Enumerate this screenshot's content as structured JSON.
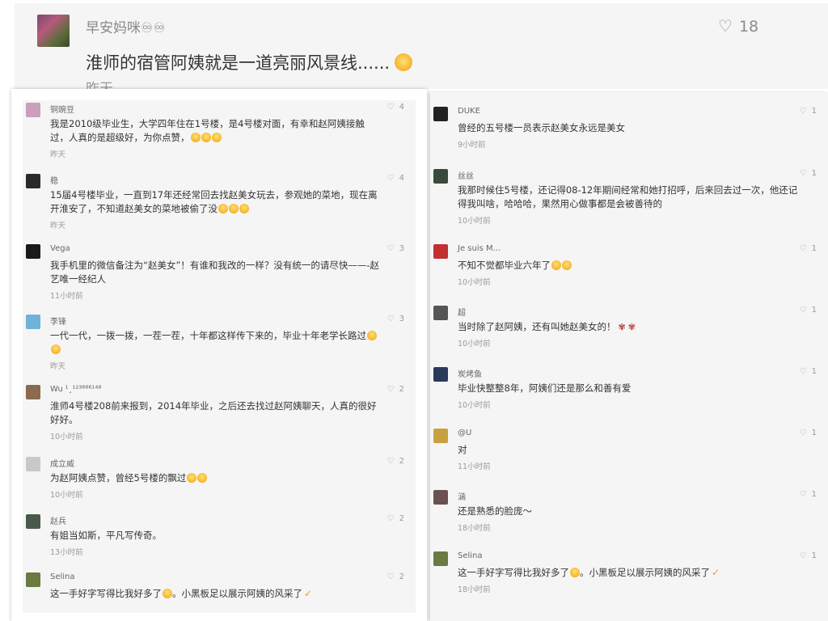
{
  "post": {
    "username": "早安妈咪",
    "username_suffix": "♾♾",
    "likes": "18",
    "text": "淮师的宿管阿姨就是一道亮丽风景线......",
    "date": "昨天"
  },
  "left_comments": [
    {
      "user": "铜豌豆",
      "likes": "4",
      "text": "我是2010级毕业生，大学四年住在1号楼，是4号楼对面，有幸和赵阿姨接触过，人真的是超级好，为你点赞，",
      "emoji": 3,
      "time": "昨天",
      "avatar": "#c8a0b8"
    },
    {
      "user": "稳",
      "likes": "4",
      "text": "15届4号楼毕业，一直到17年还经常回去找赵美女玩去，参观她的菜地，现在离开淮安了，不知道赵美女的菜地被偷了没",
      "emoji": 3,
      "time": "昨天",
      "avatar": "#2a2a2a"
    },
    {
      "user": "Vega",
      "likes": "3",
      "text": "我手机里的微信备注为“赵美女”！有谁和我改的一样？没有统一的请尽快——-赵艺唯一经纪人",
      "emoji": 0,
      "time": "11小时前",
      "avatar": "#1a1a1a"
    },
    {
      "user": "李锋",
      "likes": "3",
      "text": "一代一代，一拨一拨，一茬一茬，十年都这样传下来的，毕业十年老学长路过",
      "emoji": 2,
      "time": "昨天",
      "avatar": "#6fb3d8"
    },
    {
      "user": "Wu ¹¸¹²³⁶⁶⁶¹⁴⁸",
      "likes": "2",
      "text": "淮师4号楼208前来报到，2014年毕业，之后还去找过赵阿姨聊天，人真的很好好好。",
      "emoji": 0,
      "time": "10小时前",
      "avatar": "#8a6a50"
    },
    {
      "user": "成立威",
      "likes": "2",
      "text": "为赵阿姨点赞，曾经5号楼的飘过",
      "emoji": 2,
      "time": "10小时前",
      "avatar": "#c9c9c9"
    },
    {
      "user": "赵兵",
      "likes": "2",
      "text": "有姐当如斯，平凡写传奇。",
      "emoji": 0,
      "time": "13小时前",
      "avatar": "#4a5a4a"
    },
    {
      "user": "Selina",
      "likes": "2",
      "text": "这一手好字写得比我好多了",
      "text2": "。小黑板足以展示阿姨的风采了",
      "emoji": 1,
      "time": "",
      "avatar": "#6a7a40"
    }
  ],
  "right_comments": [
    {
      "user": "DUKE",
      "likes": "1",
      "text": "曾经的五号楼一员表示赵美女永远是美女",
      "emoji": 0,
      "time": "9小时前",
      "avatar": "#222"
    },
    {
      "user": "丝丝",
      "likes": "1",
      "text": "我那时候住5号楼，还记得08-12年期间经常和她打招呼，后来回去过一次，他还记得我叫啥，哈哈哈，果然用心做事都是会被善待的",
      "emoji": 0,
      "time": "10小时前",
      "avatar": "#3a4a3a"
    },
    {
      "user": "Je suis M...",
      "likes": "1",
      "text": "不知不觉都毕业六年了",
      "emoji": 2,
      "time": "10小时前",
      "avatar": "#c23030"
    },
    {
      "user": "超",
      "likes": "1",
      "text": "当时除了赵阿姨，还有叫她赵美女的！",
      "rose": 2,
      "emoji": 0,
      "time": "10小时前",
      "avatar": "#555"
    },
    {
      "user": "炭烤鱼",
      "likes": "1",
      "text": "毕业快整整8年，阿姨们还是那么和善有爱",
      "emoji": 0,
      "time": "10小时前",
      "avatar": "#2a3a5a"
    },
    {
      "user": "@U",
      "likes": "1",
      "text": "对",
      "emoji": 0,
      "time": "11小时前",
      "avatar": "#c9a040"
    },
    {
      "user": "涵",
      "likes": "1",
      "text": "还是熟悉的脸庞～",
      "emoji": 0,
      "time": "18小时前",
      "avatar": "#6a5050"
    },
    {
      "user": "Selina",
      "likes": "1",
      "text": "这一手好字写得比我好多了",
      "text2": "。小黑板足以展示阿姨的风采了",
      "emoji": 1,
      "time": "18小时前",
      "avatar": "#6a7a40"
    }
  ]
}
